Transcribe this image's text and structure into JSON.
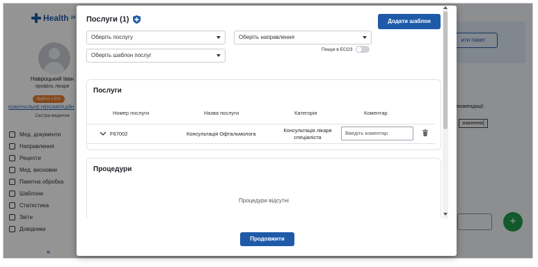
{
  "app": {
    "logo_text": "Health",
    "logo_sup": "24",
    "user": {
      "name": "Навроцький Іван",
      "role": "профіль лікаря",
      "logout_label": "Вийти з ЕН",
      "org_name": "КОМУНАЛЬНЕ НЕКОМЕРЦІЙН",
      "org_role": "Сестра медична"
    },
    "nav": [
      {
        "label": "Мед. документи",
        "icon": "documents-icon"
      },
      {
        "label": "Направлення",
        "icon": "referral-icon"
      },
      {
        "label": "Рецепти",
        "icon": "prescription-icon"
      },
      {
        "label": "Мед. висновки",
        "icon": "conclusion-icon"
      },
      {
        "label": "Пакетна обробка",
        "icon": "batch-icon"
      },
      {
        "label": "Шаблони",
        "icon": "templates-icon"
      },
      {
        "label": "Статистика",
        "icon": "statistics-icon"
      },
      {
        "label": "Звіти",
        "icon": "reports-icon"
      },
      {
        "label": "Довідники",
        "icon": "directories-icon"
      }
    ],
    "collapse_label": "«",
    "background": {
      "packet_button": "ити пакет",
      "recommendations_label": "екомендації:",
      "value_label": "значення]",
      "fab_label": "+"
    }
  },
  "modal": {
    "title": "Послуги (1)",
    "add_template_label": "Додати шаблон",
    "select_service_placeholder": "Оберіть послугу",
    "select_direction_placeholder": "Оберіть направлення",
    "select_template_placeholder": "Оберіть шаблон послуг",
    "ecoz_search_label": "Пошук в ЕСОЗ",
    "ecoz_search_enabled": false,
    "services": {
      "title": "Послуги",
      "columns": [
        "Номер послуги",
        "Назва послуги",
        "Категорія",
        "Коментар"
      ],
      "rows": [
        {
          "code": "F67002",
          "name": "Консультація Офтальмолога",
          "category_line1": "Консультація лікаря",
          "category_line2": "спеціаліста",
          "comment_placeholder": "Введіть коментар"
        }
      ]
    },
    "procedures": {
      "title": "Процедури",
      "empty_text": "Процедури відсутні"
    },
    "continue_label": "Продовжити"
  },
  "colors": {
    "primary": "#1e5aa8",
    "warning": "#e57a2c",
    "success": "#1f9b4a"
  }
}
